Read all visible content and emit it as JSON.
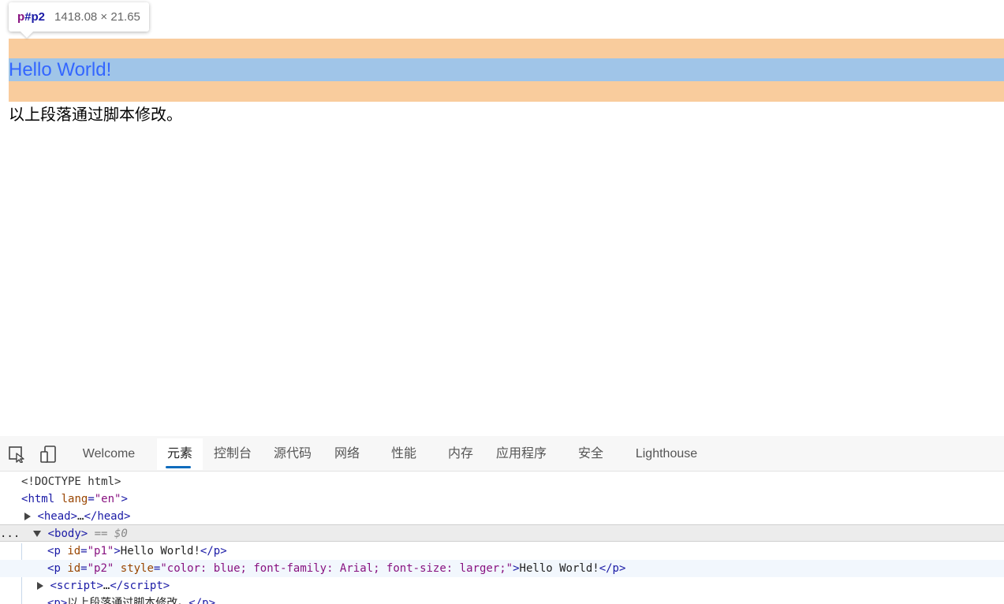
{
  "page": {
    "p1_text": "Hello World!",
    "p2_text": "Hello World!",
    "p3_text": "以上段落通过脚本修改。"
  },
  "tooltip": {
    "tag": "p",
    "id": "#p2",
    "dimensions": "1418.08 × 21.65"
  },
  "devtools": {
    "icons": [
      "inspect-element-icon",
      "device-emulation-icon"
    ],
    "tabs": [
      "Welcome",
      "元素",
      "控制台",
      "源代码",
      "网络",
      "性能",
      "内存",
      "应用程序",
      "安全",
      "Lighthouse"
    ],
    "active_tab": "元素",
    "accent_color": "#0f6cbd"
  },
  "dom": {
    "doctype": "<!DOCTYPE html>",
    "html_tag": "html",
    "html_attr_name": "lang",
    "html_attr_value": "\"en\"",
    "head_collapsed": "head",
    "body_tag": "body",
    "body_marker": "== $0",
    "ellipsis": "...",
    "p1": {
      "tag": "p",
      "attr": "id",
      "value": "\"p1\"",
      "text": "Hello World!"
    },
    "p2": {
      "tag": "p",
      "attr1": "id",
      "value1": "\"p2\"",
      "attr2": "style",
      "value2": "\"color: blue; font-family: Arial; font-size: larger;\"",
      "text": "Hello World!"
    },
    "script_tag": "script",
    "p3_partial": "以上段落通过脚本修改。"
  },
  "colors": {
    "margin_highlight": "#f9cc9d",
    "content_highlight": "#a0c5e8",
    "p2_text": "#3366ff"
  }
}
